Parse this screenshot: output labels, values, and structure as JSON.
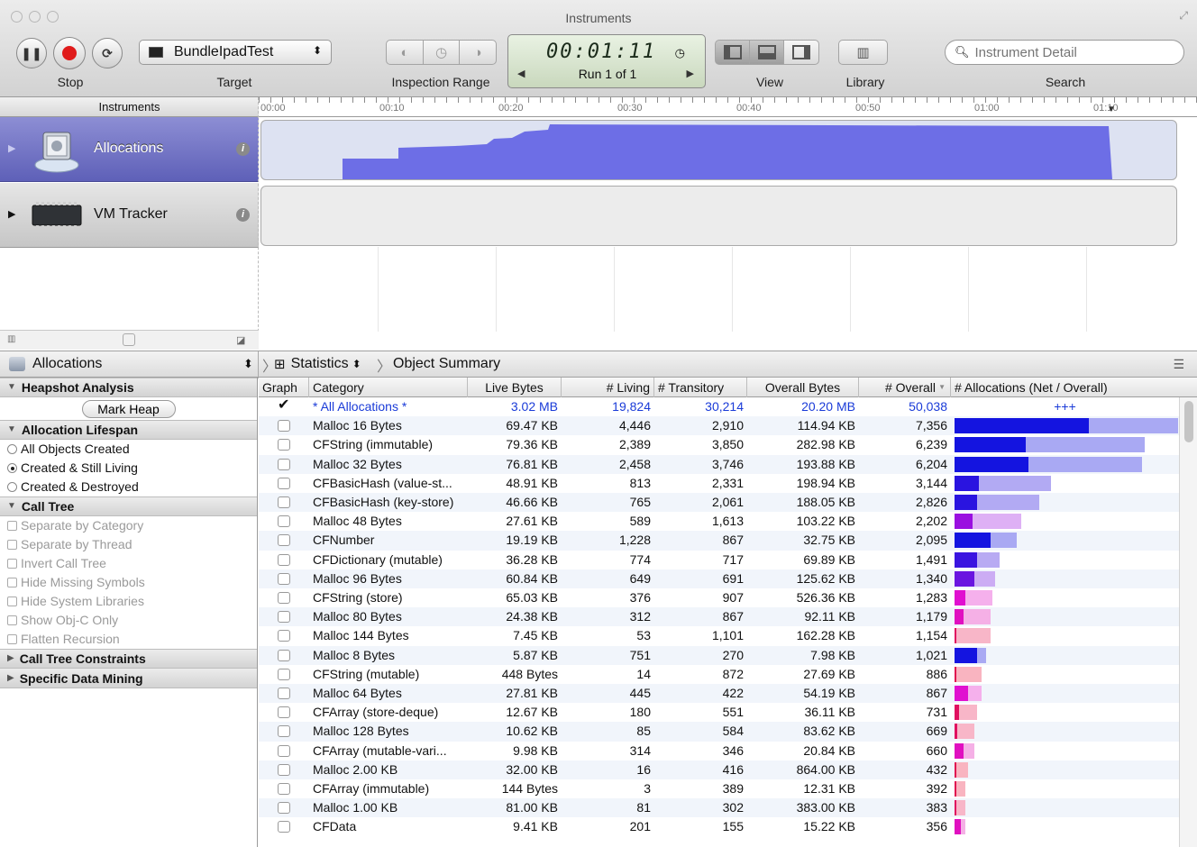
{
  "window": {
    "title": "Instruments"
  },
  "toolbar": {
    "pause_icon": "❚❚",
    "refresh_icon": "⟳",
    "stop_label": "Stop",
    "target_label": "Target",
    "target_value": "BundleIpadTest",
    "inspection_label": "Inspection Range",
    "timer": "00:01:11",
    "run": "Run 1 of 1",
    "view_label": "View",
    "library_label": "Library",
    "search_label": "Search",
    "search_placeholder": "Instrument Detail"
  },
  "timeline": {
    "header": "Instruments",
    "ticks": [
      "00:00",
      "00:10",
      "00:20",
      "00:30",
      "00:40",
      "00:50",
      "01:00",
      "01:10"
    ]
  },
  "tracks": [
    {
      "name": "Allocations",
      "info": "i"
    },
    {
      "name": "VM Tracker",
      "info": "i"
    }
  ],
  "detail": {
    "instrument": "Allocations",
    "view": "Statistics",
    "crumb": "Object Summary"
  },
  "sidebar": {
    "heapshot_title": "Heapshot Analysis",
    "mark_heap": "Mark Heap",
    "lifespan_title": "Allocation Lifespan",
    "lifespan_options": [
      "All Objects Created",
      "Created & Still Living",
      "Created & Destroyed"
    ],
    "lifespan_selected": 1,
    "calltree_title": "Call Tree",
    "calltree_options": [
      "Separate by Category",
      "Separate by Thread",
      "Invert Call Tree",
      "Hide Missing Symbols",
      "Hide System Libraries",
      "Show Obj-C Only",
      "Flatten Recursion"
    ],
    "constraints_title": "Call Tree Constraints",
    "mining_title": "Specific Data Mining"
  },
  "table": {
    "columns": [
      "Graph",
      "Category",
      "Live Bytes",
      "# Living",
      "# Transitory",
      "Overall Bytes",
      "# Overall",
      "# Allocations (Net / Overall)"
    ],
    "sort_indicator": "▼",
    "summary_marker": "+++",
    "rows": [
      {
        "graph": true,
        "category": "* All Allocations *",
        "live_bytes": "3.02 MB",
        "living": "19,824",
        "transitory": "30,214",
        "overall_bytes": "20.20 MB",
        "overall": "50,038",
        "net_frac": null,
        "tot_frac": null,
        "color": "#1a3bd8"
      },
      {
        "graph": false,
        "category": "Malloc 16 Bytes",
        "live_bytes": "69.47 KB",
        "living": "4,446",
        "transitory": "2,910",
        "overall_bytes": "114.94 KB",
        "overall": "7,356",
        "net_frac": 0.6,
        "tot_frac": 1.0,
        "color": "#1414e0",
        "light": "#a9a9f3"
      },
      {
        "graph": false,
        "category": "CFString (immutable)",
        "live_bytes": "79.36 KB",
        "living": "2,389",
        "transitory": "3,850",
        "overall_bytes": "282.98 KB",
        "overall": "6,239",
        "net_frac": 0.32,
        "tot_frac": 0.85,
        "color": "#1414e0",
        "light": "#a9a9f3"
      },
      {
        "graph": false,
        "category": "Malloc 32 Bytes",
        "live_bytes": "76.81 KB",
        "living": "2,458",
        "transitory": "3,746",
        "overall_bytes": "193.88 KB",
        "overall": "6,204",
        "net_frac": 0.33,
        "tot_frac": 0.84,
        "color": "#1414e0",
        "light": "#a9a9f3"
      },
      {
        "graph": false,
        "category": "CFBasicHash (value-st...",
        "live_bytes": "48.91 KB",
        "living": "813",
        "transitory": "2,331",
        "overall_bytes": "198.94 KB",
        "overall": "3,144",
        "net_frac": 0.11,
        "tot_frac": 0.43,
        "color": "#2a14e0",
        "light": "#b2aaf3"
      },
      {
        "graph": false,
        "category": "CFBasicHash (key-store)",
        "live_bytes": "46.66 KB",
        "living": "765",
        "transitory": "2,061",
        "overall_bytes": "188.05 KB",
        "overall": "2,826",
        "net_frac": 0.1,
        "tot_frac": 0.38,
        "color": "#2a14e0",
        "light": "#b2aaf3"
      },
      {
        "graph": false,
        "category": "Malloc 48 Bytes",
        "live_bytes": "27.61 KB",
        "living": "589",
        "transitory": "1,613",
        "overall_bytes": "103.22 KB",
        "overall": "2,202",
        "net_frac": 0.08,
        "tot_frac": 0.3,
        "color": "#9a10e0",
        "light": "#deb0f5"
      },
      {
        "graph": false,
        "category": "CFNumber",
        "live_bytes": "19.19 KB",
        "living": "1,228",
        "transitory": "867",
        "overall_bytes": "32.75 KB",
        "overall": "2,095",
        "net_frac": 0.16,
        "tot_frac": 0.28,
        "color": "#1414e0",
        "light": "#a9a9f3"
      },
      {
        "graph": false,
        "category": "CFDictionary (mutable)",
        "live_bytes": "36.28 KB",
        "living": "774",
        "transitory": "717",
        "overall_bytes": "69.89 KB",
        "overall": "1,491",
        "net_frac": 0.1,
        "tot_frac": 0.2,
        "color": "#3a14e0",
        "light": "#b8aaf3"
      },
      {
        "graph": false,
        "category": "Malloc 96 Bytes",
        "live_bytes": "60.84 KB",
        "living": "649",
        "transitory": "691",
        "overall_bytes": "125.62 KB",
        "overall": "1,340",
        "net_frac": 0.09,
        "tot_frac": 0.18,
        "color": "#6a14e0",
        "light": "#ccacf4"
      },
      {
        "graph": false,
        "category": "CFString (store)",
        "live_bytes": "65.03 KB",
        "living": "376",
        "transitory": "907",
        "overall_bytes": "526.36 KB",
        "overall": "1,283",
        "net_frac": 0.05,
        "tot_frac": 0.17,
        "color": "#e010d0",
        "light": "#f5b0ec"
      },
      {
        "graph": false,
        "category": "Malloc 80 Bytes",
        "live_bytes": "24.38 KB",
        "living": "312",
        "transitory": "867",
        "overall_bytes": "92.11 KB",
        "overall": "1,179",
        "net_frac": 0.04,
        "tot_frac": 0.16,
        "color": "#e010c0",
        "light": "#f5b0e6"
      },
      {
        "graph": false,
        "category": "Malloc 144 Bytes",
        "live_bytes": "7.45 KB",
        "living": "53",
        "transitory": "1,101",
        "overall_bytes": "162.28 KB",
        "overall": "1,154",
        "net_frac": 0.008,
        "tot_frac": 0.16,
        "color": "#e01060",
        "light": "#f8b6c8"
      },
      {
        "graph": false,
        "category": "Malloc 8 Bytes",
        "live_bytes": "5.87 KB",
        "living": "751",
        "transitory": "270",
        "overall_bytes": "7.98 KB",
        "overall": "1,021",
        "net_frac": 0.1,
        "tot_frac": 0.14,
        "color": "#1414e0",
        "light": "#a9a9f3"
      },
      {
        "graph": false,
        "category": "CFString (mutable)",
        "live_bytes": "448 Bytes",
        "living": "14",
        "transitory": "872",
        "overall_bytes": "27.69 KB",
        "overall": "886",
        "net_frac": 0.0,
        "tot_frac": 0.12,
        "color": "#e01050",
        "light": "#f9b4c0"
      },
      {
        "graph": false,
        "category": "Malloc 64 Bytes",
        "live_bytes": "27.81 KB",
        "living": "445",
        "transitory": "422",
        "overall_bytes": "54.19 KB",
        "overall": "867",
        "net_frac": 0.06,
        "tot_frac": 0.12,
        "color": "#e010d0",
        "light": "#f5b0ec"
      },
      {
        "graph": false,
        "category": "CFArray (store-deque)",
        "live_bytes": "12.67 KB",
        "living": "180",
        "transitory": "551",
        "overall_bytes": "36.11 KB",
        "overall": "731",
        "net_frac": 0.02,
        "tot_frac": 0.1,
        "color": "#e01060",
        "light": "#f8b6c8"
      },
      {
        "graph": false,
        "category": "Malloc 128 Bytes",
        "live_bytes": "10.62 KB",
        "living": "85",
        "transitory": "584",
        "overall_bytes": "83.62 KB",
        "overall": "669",
        "net_frac": 0.012,
        "tot_frac": 0.09,
        "color": "#e01060",
        "light": "#f8b6c8"
      },
      {
        "graph": false,
        "category": "CFArray (mutable-vari...",
        "live_bytes": "9.98 KB",
        "living": "314",
        "transitory": "346",
        "overall_bytes": "20.84 KB",
        "overall": "660",
        "net_frac": 0.04,
        "tot_frac": 0.09,
        "color": "#e010c0",
        "light": "#f5b0e6"
      },
      {
        "graph": false,
        "category": "Malloc 2.00 KB",
        "live_bytes": "32.00 KB",
        "living": "16",
        "transitory": "416",
        "overall_bytes": "864.00 KB",
        "overall": "432",
        "net_frac": 0.0,
        "tot_frac": 0.06,
        "color": "#e01050",
        "light": "#f9b4c0"
      },
      {
        "graph": false,
        "category": "CFArray (immutable)",
        "live_bytes": "144 Bytes",
        "living": "3",
        "transitory": "389",
        "overall_bytes": "12.31 KB",
        "overall": "392",
        "net_frac": 0.0,
        "tot_frac": 0.05,
        "color": "#e01050",
        "light": "#f9b4c0"
      },
      {
        "graph": false,
        "category": "Malloc 1.00 KB",
        "live_bytes": "81.00 KB",
        "living": "81",
        "transitory": "302",
        "overall_bytes": "383.00 KB",
        "overall": "383",
        "net_frac": 0.01,
        "tot_frac": 0.05,
        "color": "#e01060",
        "light": "#f8b6c8"
      },
      {
        "graph": false,
        "category": "CFData",
        "live_bytes": "9.41 KB",
        "living": "201",
        "transitory": "155",
        "overall_bytes": "15.22 KB",
        "overall": "356",
        "net_frac": 0.03,
        "tot_frac": 0.05,
        "color": "#e010c0",
        "light": "#f5b0e6"
      }
    ]
  }
}
